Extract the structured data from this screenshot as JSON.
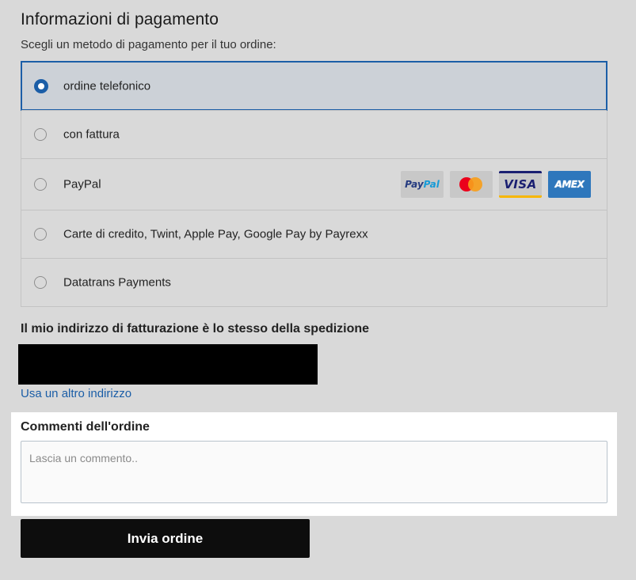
{
  "payment": {
    "title": "Informazioni di pagamento",
    "subtitle": "Scegli un metodo di pagamento per il tuo ordine:",
    "methods": [
      {
        "label": "ordine telefonico",
        "selected": true
      },
      {
        "label": "con fattura",
        "selected": false
      },
      {
        "label": "PayPal",
        "selected": false,
        "logos": [
          "paypal-logo",
          "mastercard-logo",
          "visa-logo",
          "amex-logo"
        ]
      },
      {
        "label": "Carte di credito, Twint, Apple Pay, Google Pay by Payrexx",
        "selected": false
      },
      {
        "label": "Datatrans Payments",
        "selected": false
      }
    ],
    "logos": {
      "paypal_pay": "Pay",
      "paypal_pal": "Pal",
      "visa": "VISA",
      "amex": "AMEX"
    }
  },
  "billing": {
    "heading": "Il mio indirizzo di fatturazione è lo stesso della spedizione",
    "alt_link": "Usa un altro indirizzo"
  },
  "comments": {
    "label": "Commenti dell'ordine",
    "placeholder": "Lascia un commento..",
    "value": ""
  },
  "submit": {
    "label": "Invia ordine"
  },
  "colors": {
    "accent": "#1b5ea7",
    "background": "#d9d9d9",
    "button": "#0d0d0d"
  }
}
